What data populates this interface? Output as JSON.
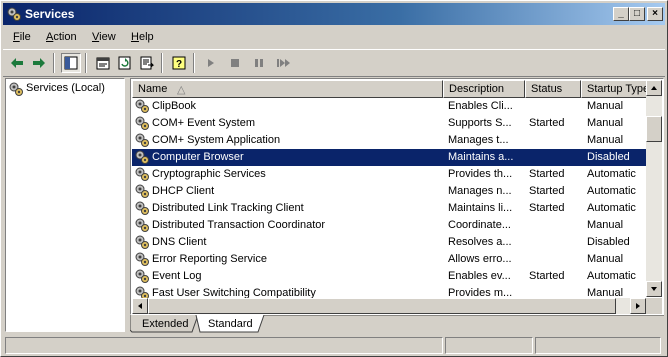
{
  "window": {
    "title": "Services",
    "icon": "services-gear-icon"
  },
  "title_buttons": {
    "minimize": "_",
    "maximize": "□",
    "close": "×"
  },
  "menu": [
    {
      "prefix": "",
      "accel": "F",
      "rest": "ile"
    },
    {
      "prefix": "",
      "accel": "A",
      "rest": "ction"
    },
    {
      "prefix": "",
      "accel": "V",
      "rest": "iew"
    },
    {
      "prefix": "",
      "accel": "H",
      "rest": "elp"
    }
  ],
  "toolbar": [
    "back-arrow-icon",
    "forward-arrow-icon",
    "show-hide-tree-icon",
    "properties-icon",
    "refresh-icon",
    "export-list-icon",
    "help-icon",
    "start-service-icon",
    "stop-service-icon",
    "pause-service-icon",
    "restart-service-icon"
  ],
  "tree": {
    "root_label": "Services (Local)"
  },
  "columns": {
    "name": "Name",
    "description": "Description",
    "status": "Status",
    "startup": "Startup Type",
    "sort_indicator": "△"
  },
  "services": [
    {
      "name": "ClipBook",
      "description": "Enables Cli...",
      "status": "",
      "startup": "Manual"
    },
    {
      "name": "COM+ Event System",
      "description": "Supports S...",
      "status": "Started",
      "startup": "Manual"
    },
    {
      "name": "COM+ System Application",
      "description": "Manages t...",
      "status": "",
      "startup": "Manual"
    },
    {
      "name": "Computer Browser",
      "description": "Maintains a...",
      "status": "",
      "startup": "Disabled",
      "selected": true
    },
    {
      "name": "Cryptographic Services",
      "description": "Provides th...",
      "status": "Started",
      "startup": "Automatic"
    },
    {
      "name": "DHCP Client",
      "description": "Manages n...",
      "status": "Started",
      "startup": "Automatic"
    },
    {
      "name": "Distributed Link Tracking Client",
      "description": "Maintains li...",
      "status": "Started",
      "startup": "Automatic"
    },
    {
      "name": "Distributed Transaction Coordinator",
      "description": "Coordinate...",
      "status": "",
      "startup": "Manual"
    },
    {
      "name": "DNS Client",
      "description": "Resolves a...",
      "status": "",
      "startup": "Disabled"
    },
    {
      "name": "Error Reporting Service",
      "description": "Allows erro...",
      "status": "",
      "startup": "Manual"
    },
    {
      "name": "Event Log",
      "description": "Enables ev...",
      "status": "Started",
      "startup": "Automatic"
    },
    {
      "name": "Fast User Switching Compatibility",
      "description": "Provides m...",
      "status": "",
      "startup": "Manual"
    }
  ],
  "tabs": [
    {
      "label": "Extended"
    },
    {
      "label": "Standard",
      "active": true
    }
  ],
  "colors": {
    "selection": "#0a246a",
    "titlebar_start": "#0a246a",
    "titlebar_end": "#a6caf0",
    "face": "#d4d0c8"
  }
}
